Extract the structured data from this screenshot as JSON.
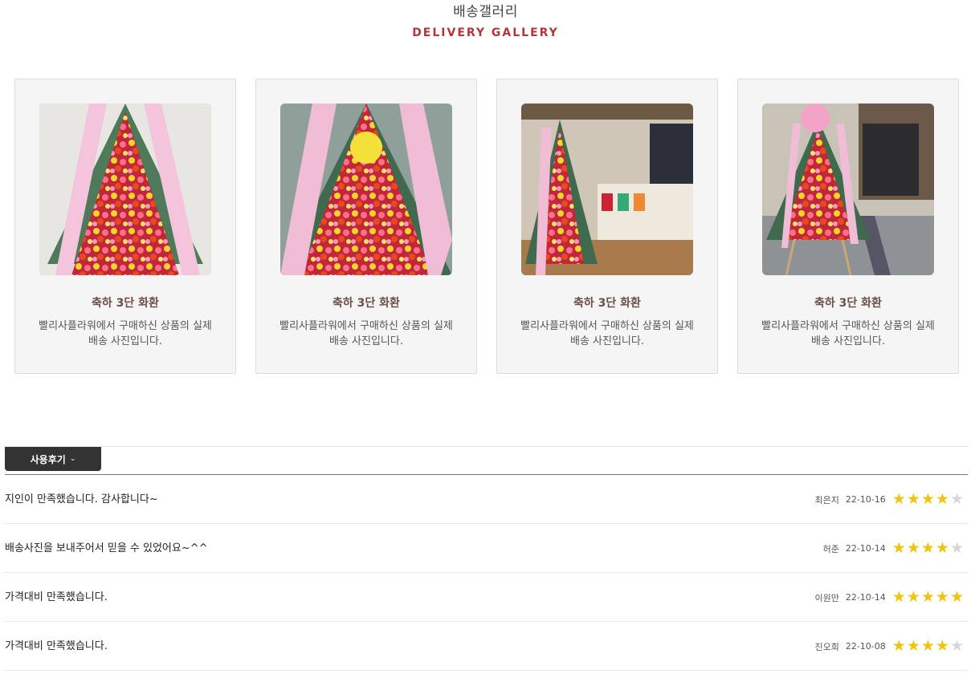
{
  "gallery": {
    "title": "배송갤러리",
    "subtitle": "DELIVERY GALLERY",
    "items": [
      {
        "title": "축하 3단 화환",
        "description": "빨리사플라워에서 구매하신 상품의 실제 배송 사진입니다."
      },
      {
        "title": "축하 3단 화환",
        "description": "빨리사플라워에서 구매하신 상품의 실제 배송 사진입니다."
      },
      {
        "title": "축하 3단 화환",
        "description": "빨리사플라워에서 구매하신 상품의 실제 배송 사진입니다."
      },
      {
        "title": "축하 3단 화환",
        "description": "빨리사플라워에서 구매하신 상품의 실제 배송 사진입니다."
      }
    ]
  },
  "reviews": {
    "tab_label": "사용후기",
    "star_color": "#f0c30f",
    "items": [
      {
        "text": "지인이 만족했습니다. 감사합니다~",
        "author": "최은지",
        "date": "22-10-16",
        "rating": 4
      },
      {
        "text": "배송사진을 보내주어서 믿을 수 있었어요~^^",
        "author": "허준",
        "date": "22-10-14",
        "rating": 4
      },
      {
        "text": "가격대비 만족했습니다.",
        "author": "이원만",
        "date": "22-10-14",
        "rating": 5
      },
      {
        "text": "가격대비 만족했습니다.",
        "author": "진오희",
        "date": "22-10-08",
        "rating": 4
      }
    ]
  }
}
